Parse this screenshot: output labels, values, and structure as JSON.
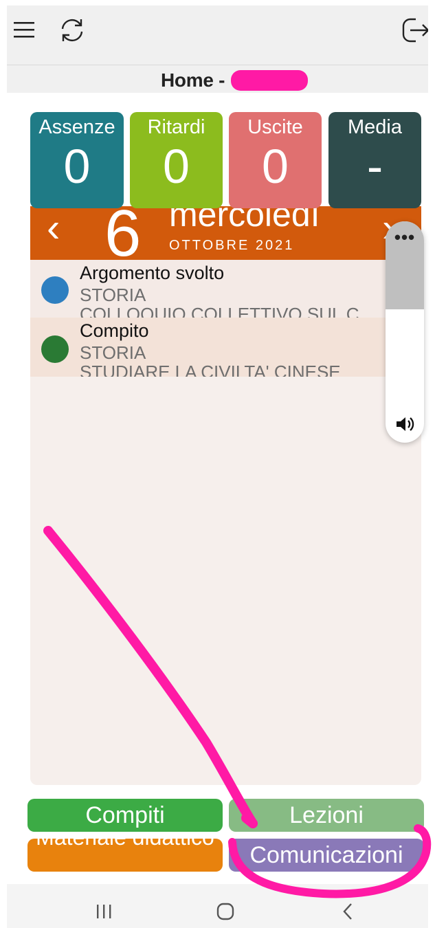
{
  "header": {
    "title": "Home -"
  },
  "stats": [
    {
      "label": "Assenze",
      "value": "0",
      "color": "#1f7b86"
    },
    {
      "label": "Ritardi",
      "value": "0",
      "color": "#8cbc1e"
    },
    {
      "label": "Uscite",
      "value": "0",
      "color": "#e07070"
    },
    {
      "label": "Media",
      "value": "-",
      "color": "#2e4c4c"
    }
  ],
  "day": {
    "prev": "‹",
    "number": "6",
    "weekday": "mercoledì",
    "month_year": "OTTOBRE 2021",
    "next": "›"
  },
  "events": [
    {
      "title": "Argomento svolto",
      "subject": "STORIA",
      "description": "COLLOQUIO COLLETTIVO SUL C",
      "color": "#2e7fc0"
    },
    {
      "title": "Compito",
      "subject": "STORIA",
      "description": "STUDIARE LA CIVILTA' CINESE",
      "color": "#2a7a34"
    }
  ],
  "volume_overlay": {
    "more": "•••"
  },
  "buttons": {
    "compiti": "Compiti",
    "lezioni": "Lezioni",
    "materiale": "Materiale didattico",
    "comunicazioni": "Comunicazioni"
  },
  "icons": [
    "menu-icon",
    "sync-icon",
    "logout-icon",
    "speaker-icon",
    "recents-icon",
    "home-icon",
    "back-icon"
  ]
}
